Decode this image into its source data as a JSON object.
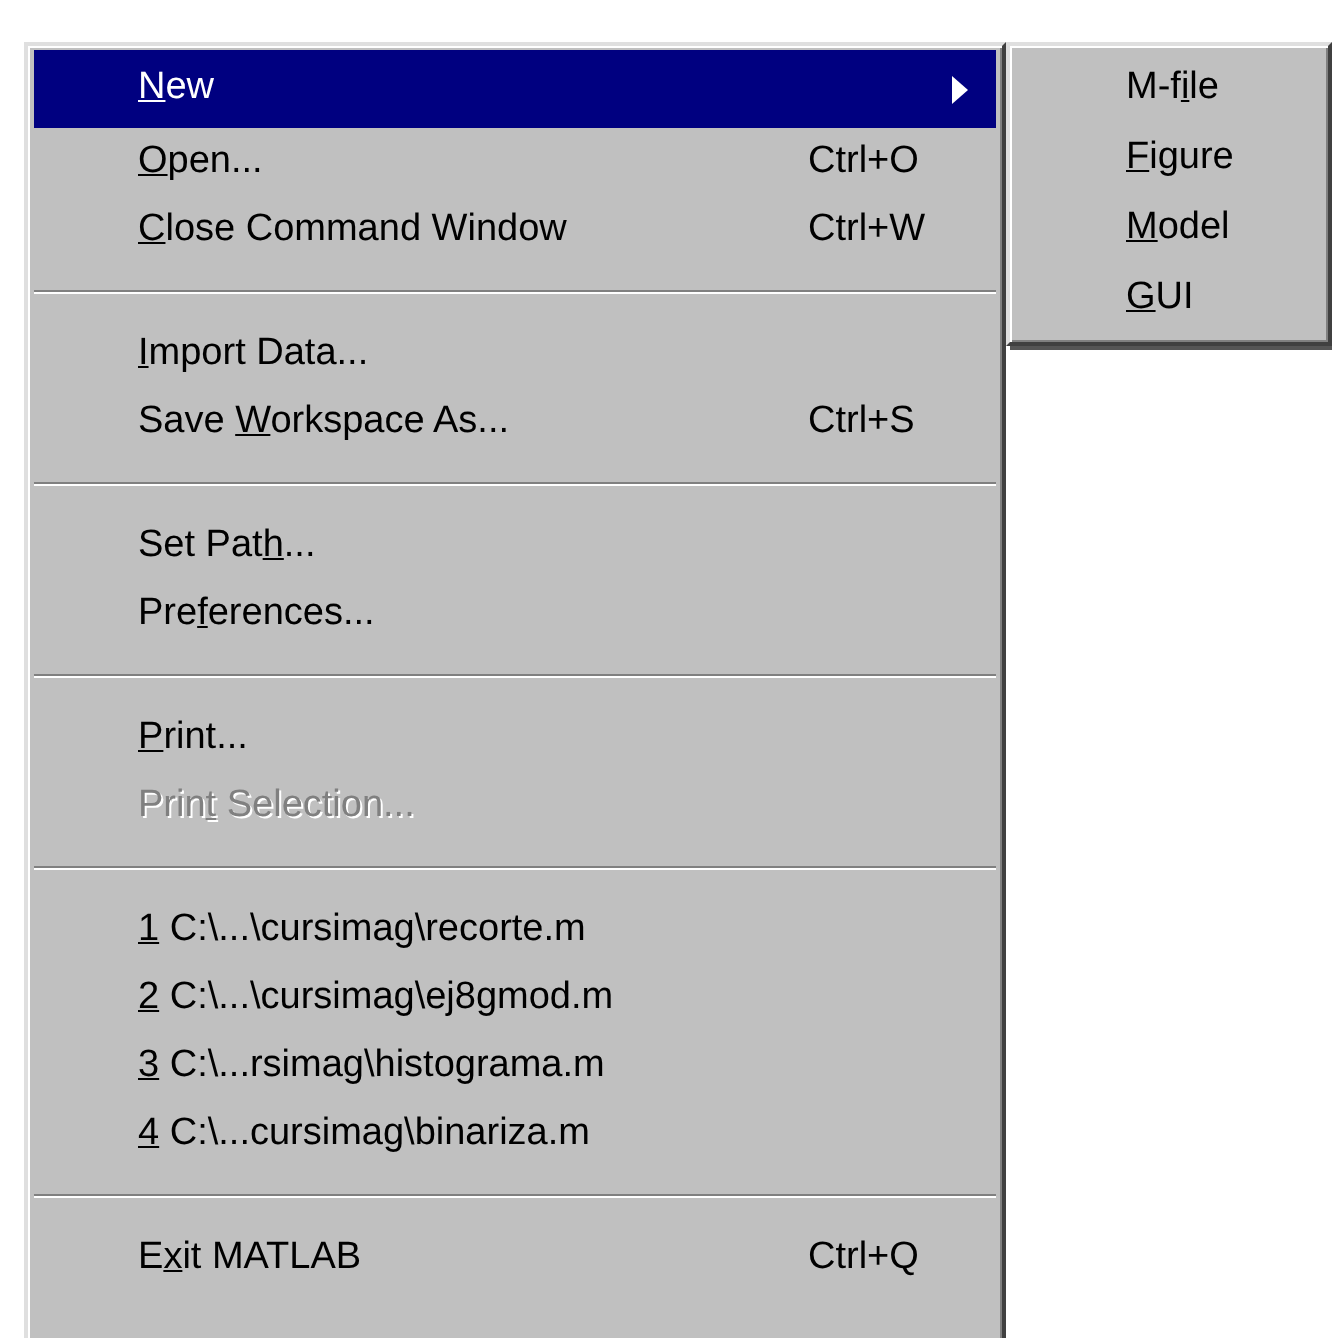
{
  "menu": [
    {
      "kind": "item",
      "key": "N",
      "after": "ew",
      "selected": true,
      "submenu": true
    },
    {
      "kind": "item",
      "key": "O",
      "after": "pen...",
      "shortcut": "Ctrl+O",
      "selected": false
    },
    {
      "kind": "item",
      "key": "C",
      "after": "lose Command Window",
      "shortcut": "Ctrl+W",
      "selected": false
    },
    {
      "kind": "separator"
    },
    {
      "kind": "item",
      "key": "I",
      "after": "mport Data...",
      "selected": false
    },
    {
      "kind": "item",
      "before": "Save ",
      "key": "W",
      "after": "orkspace As...",
      "shortcut": "Ctrl+S",
      "selected": false
    },
    {
      "kind": "separator"
    },
    {
      "kind": "item",
      "before": "Set Pat",
      "key": "h",
      "after": "...",
      "selected": false
    },
    {
      "kind": "item",
      "before": "Pre",
      "key": "f",
      "after": "erences...",
      "selected": false
    },
    {
      "kind": "separator"
    },
    {
      "kind": "item",
      "key": "P",
      "after": "rint...",
      "selected": false
    },
    {
      "kind": "item",
      "before": "Prin",
      "key": "t",
      "after": " Selection...",
      "selected": false,
      "disabled": true
    },
    {
      "kind": "separator"
    },
    {
      "kind": "item",
      "key": "1",
      "after": " C:\\...\\cursimag\\recorte.m",
      "selected": false
    },
    {
      "kind": "item",
      "key": "2",
      "after": " C:\\...\\cursimag\\ej8gmod.m",
      "selected": false
    },
    {
      "kind": "item",
      "key": "3",
      "after": " C:\\...rsimag\\histograma.m",
      "selected": false
    },
    {
      "kind": "item",
      "key": "4",
      "after": " C:\\...cursimag\\binariza.m",
      "selected": false
    },
    {
      "kind": "separator"
    },
    {
      "kind": "item",
      "before": "E",
      "key": "x",
      "after": "it MATLAB",
      "shortcut": "Ctrl+Q",
      "selected": false
    }
  ],
  "submenu": [
    {
      "before": "M-f",
      "key": "i",
      "after": "le"
    },
    {
      "key": "F",
      "after": "igure"
    },
    {
      "key": "M",
      "after": "odel"
    },
    {
      "key": "G",
      "after": "UI"
    }
  ]
}
